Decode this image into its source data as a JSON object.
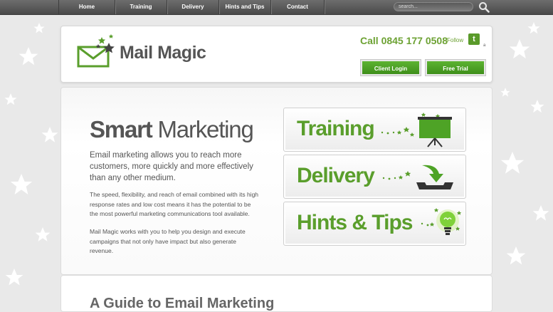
{
  "nav": {
    "items": [
      {
        "label": "Home"
      },
      {
        "label": "Training"
      },
      {
        "label": "Delivery"
      },
      {
        "label": "Hints and Tips"
      },
      {
        "label": "Contact"
      }
    ],
    "search_placeholder": "search..."
  },
  "header": {
    "logo_text": "Mail Magic",
    "phone": "Call 0845 177 0508",
    "follow_label": "Follow",
    "twitter_glyph": "t",
    "twitter_suffix": "a",
    "client_login_label": "Client Login",
    "free_trial_label": "Free Trial"
  },
  "main": {
    "headline_bold": "Smart",
    "headline_rest": " Marketing",
    "lead": "Email marketing allows you to reach more customers, more quickly and more effectively than any other medium.",
    "paragraph1": "The speed, flexibility, and reach of email combined with its high response rates and low cost means it has the potential to be the most powerful marketing communications tool available.",
    "paragraph2": "Mail Magic works with you to help you design and execute campaigns that not only have impact but also generate revenue.",
    "promos": [
      {
        "label": "Training",
        "icon": "presentation-board-icon"
      },
      {
        "label": "Delivery",
        "icon": "download-tray-icon"
      },
      {
        "label": "Hints & Tips",
        "icon": "lightbulb-icon"
      }
    ]
  },
  "lower": {
    "title": "A Guide to Email Marketing"
  },
  "colors": {
    "brand_green": "#6da234",
    "button_green": "#4ea326",
    "nav_dark": "#555555",
    "text_grey": "#555555"
  }
}
